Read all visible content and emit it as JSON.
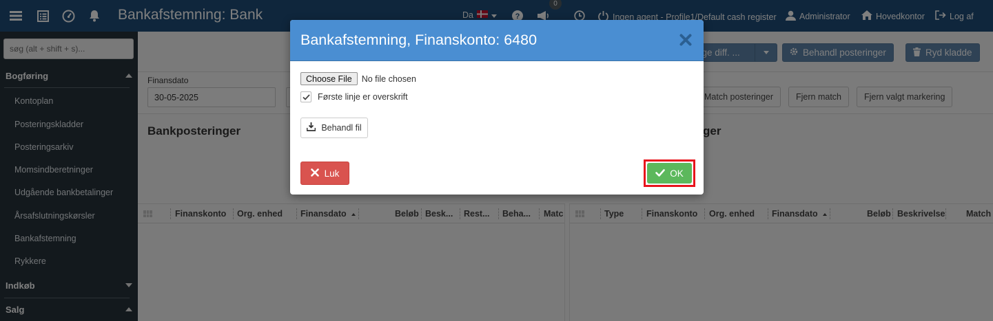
{
  "topbar": {
    "title": "Bankafstemning: Bank",
    "language": "Da",
    "notifications_count": "0",
    "agent_status": "Ingen agent - Profile1/Default cash register",
    "user": "Administrator",
    "office": "Hovedkontor",
    "logout": "Log af",
    "colors": {
      "bar": "#1e4d78"
    }
  },
  "sidebar": {
    "search_placeholder": "søg (alt + shift + s)...",
    "sections": [
      {
        "label": "Bogføring",
        "expanded": true
      },
      {
        "label": "Indkøb",
        "expanded": false
      },
      {
        "label": "Salg",
        "expanded": true
      }
    ],
    "items": [
      "Kontoplan",
      "Posteringskladder",
      "Posteringsarkiv",
      "Momsindberetninger",
      "Udgående bankbetalinger",
      "Årsafslutningskørsler",
      "Bankafstemning",
      "Rykkere"
    ]
  },
  "toolbar": {
    "diff_button": "age diff. ...",
    "process_button": "Behandl posteringer",
    "clean_button": "Ryd kladde"
  },
  "filter": {
    "date_label": "Finansdato",
    "date_value": "30-05-2025",
    "match_button": "Match posteringer",
    "remove_match_button": "Fjern match",
    "remove_marking_button": "Fjern valgt markering"
  },
  "left_panel": {
    "title": "Bankposteringer",
    "columns": [
      "Finanskonto",
      "Org. enhed",
      "Finansdato",
      "Beløb",
      "Besk...",
      "Rest...",
      "Beha...",
      "Matc"
    ]
  },
  "right_panel": {
    "title_fragment": "ger",
    "columns": [
      "Type",
      "Finanskonto",
      "Org. enhed",
      "Finansdato",
      "Beløb",
      "Beskrivelse",
      "Match"
    ]
  },
  "modal": {
    "title": "Bankafstemning, Finanskonto: 6480",
    "choose_file": "Choose File",
    "no_file": "No file chosen",
    "first_line_header": "Første linje er overskrift",
    "first_line_checked": true,
    "process_file": "Behandl fil",
    "close_button": "Luk",
    "ok_button": "OK",
    "colors": {
      "header": "#4a8ed2",
      "close": "#d9534f",
      "ok": "#5cb85c",
      "highlight": "#e8141c"
    }
  }
}
